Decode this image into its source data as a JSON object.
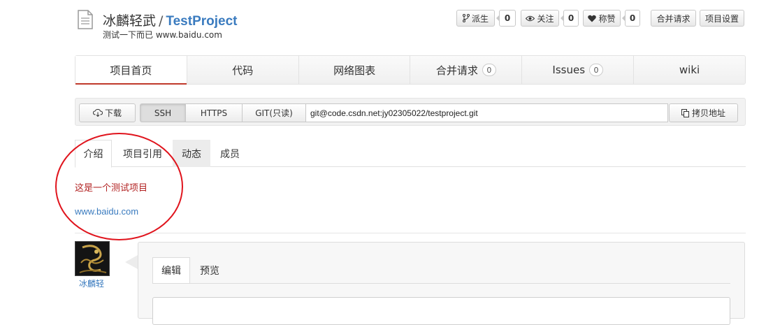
{
  "header": {
    "owner": "冰麟轻武",
    "separator": "/",
    "project": "TestProject",
    "description": "测试一下而已 www.baidu.com"
  },
  "actions": {
    "fork_label": "派生",
    "fork_count": "0",
    "watch_label": "关注",
    "watch_count": "0",
    "like_label": "称赞",
    "like_count": "0",
    "merge_label": "合并请求",
    "settings_label": "项目设置"
  },
  "nav": {
    "home": "项目首页",
    "code": "代码",
    "graph": "网络图表",
    "merge": "合并请求",
    "merge_count": "0",
    "issues": "Issues",
    "issues_count": "0",
    "wiki": "wiki"
  },
  "clone": {
    "download": "下载",
    "ssh": "SSH",
    "https": "HTTPS",
    "git_readonly": "GIT(只读)",
    "url": "git@code.csdn.net:jy02305022/testproject.git",
    "copy": "拷贝地址"
  },
  "subtabs": {
    "intro": "介绍",
    "references": "项目引用",
    "activity": "动态",
    "members": "成员"
  },
  "intro": {
    "text": "这是一个测试项目",
    "link": "www.baidu.com"
  },
  "comment": {
    "user": "冰麟轻",
    "edit_tab": "编辑",
    "preview_tab": "预览"
  },
  "colors": {
    "accent_red": "#c0392b",
    "link_blue": "#3a7bbf",
    "annotation_red": "#e0141d"
  }
}
